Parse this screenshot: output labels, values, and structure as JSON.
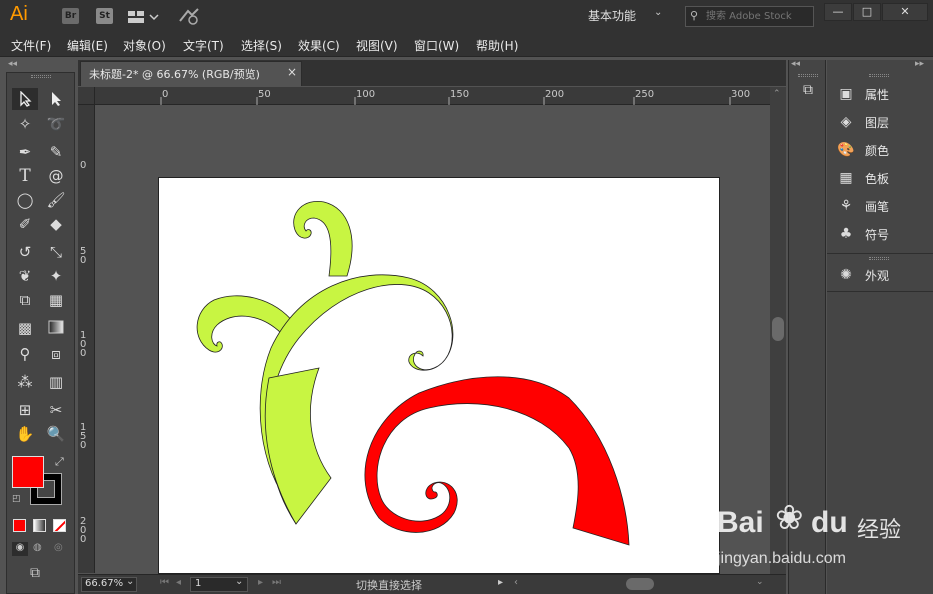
{
  "app": {
    "logo": "Ai",
    "bridge_label": "Br",
    "stock_label": "St",
    "workspace": "基本功能",
    "search_placeholder": "搜索 Adobe Stock",
    "win_min": "—",
    "win_max": "□",
    "win_close": "✕"
  },
  "menu": {
    "items": [
      "文件(F)",
      "编辑(E)",
      "对象(O)",
      "文字(T)",
      "选择(S)",
      "效果(C)",
      "视图(V)",
      "窗口(W)",
      "帮助(H)"
    ]
  },
  "document": {
    "tab_title": "未标题-2* @ 66.67% (RGB/预览)",
    "close_glyph": "×"
  },
  "rulers": {
    "h_ticks": [
      "0",
      "50",
      "100",
      "150",
      "200",
      "250",
      "300"
    ],
    "v_ticks": [
      "0",
      "5\n0",
      "1\n0\n0",
      "1\n5\n0",
      "2\n0\n0"
    ]
  },
  "status": {
    "zoom": "66.67%",
    "artboard": "1",
    "tool_hint": "切换直接选择"
  },
  "panels": {
    "items": [
      {
        "label": "属性",
        "icon": "properties-icon"
      },
      {
        "label": "图层",
        "icon": "layers-icon"
      },
      {
        "label": "颜色",
        "icon": "color-palette-icon"
      },
      {
        "label": "色板",
        "icon": "swatches-icon"
      },
      {
        "label": "画笔",
        "icon": "brush-icon"
      },
      {
        "label": "符号",
        "icon": "club-symbol-icon"
      },
      {
        "label": "外观",
        "icon": "appearance-icon"
      }
    ]
  },
  "colors": {
    "fill": "#ff0000",
    "stroke": "#000000",
    "green_shape": "#c8f542",
    "red_shape": "#ff0000"
  },
  "watermark": {
    "brand": "Bai",
    "brand2": "du",
    "cn": "经验",
    "url": "jingyan.baidu.com"
  }
}
